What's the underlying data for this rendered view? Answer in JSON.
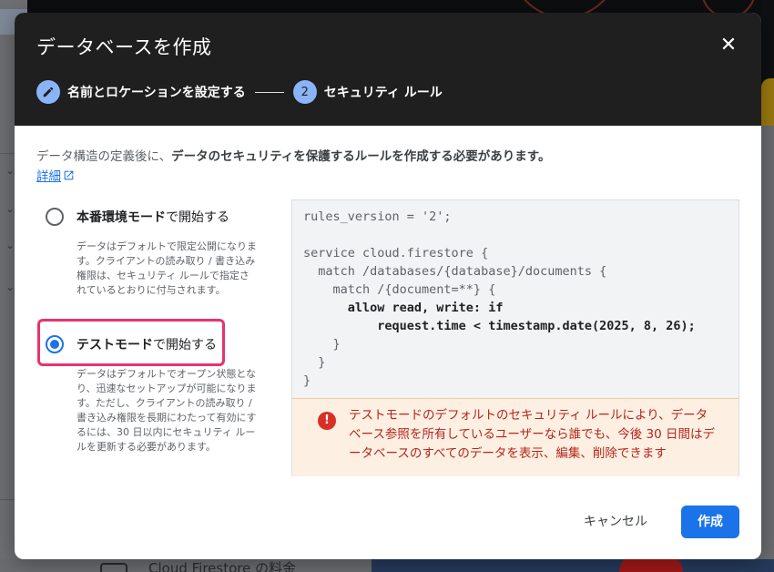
{
  "dialog": {
    "title": "データベースを作成",
    "stepper": {
      "step1_label": "名前とロケーションを設定する",
      "step2_number": "2",
      "step2_label": "セキュリティ ルール"
    },
    "intro_plain": "データ構造の定義後に、",
    "intro_bold": "データのセキュリティを保護するルールを作成する必要があります。",
    "details_link": "詳細",
    "production_option": {
      "label_bold": "本番環境モード",
      "label_rest": "で開始する",
      "description": "データはデフォルトで限定公開になります。クライアントの読み取り / 書き込み権限は、セキュリティ ルールで指定されているとおりに付与されます。",
      "selected": false
    },
    "test_option": {
      "label_bold": "テストモード",
      "label_rest": "で開始する",
      "description": "データはデフォルトでオープン状態となり、迅速なセットアップが可能になります。ただし、クライアントの読み取り / 書き込み権限を長期にわたって有効にするには、30 日以内にセキュリティ ルールを更新する必要があります。",
      "selected": true
    },
    "code": {
      "line1": "rules_version = '2';",
      "line2": "service cloud.firestore {",
      "line3": "  match /databases/{database}/documents {",
      "line4": "    match /{document=**} {",
      "line5": "      allow read, write: if",
      "line6": "          request.time < timestamp.date(2025, 8, 26);",
      "line7": "    }",
      "line8": "  }",
      "line9": "}"
    },
    "warning_icon": "!",
    "warning_text": "テストモードのデフォルトのセキュリティ ルールにより、データベース参照を所有しているユーザーなら誰でも、今後 30 日間はデータベースのすべてのデータを表示、編集、削除できます",
    "cancel_label": "キャンセル",
    "create_label": "作成",
    "close_icon": "✕"
  },
  "background": {
    "bottom_text": "Cloud Firestore の料金"
  },
  "colors": {
    "accent": "#1a73e8",
    "header_bg": "#1f1f1f",
    "step_circle": "#8ab4f8",
    "highlight": "#e8336d",
    "warning_bg": "#fdefe1",
    "warning_text": "#b3261e"
  }
}
